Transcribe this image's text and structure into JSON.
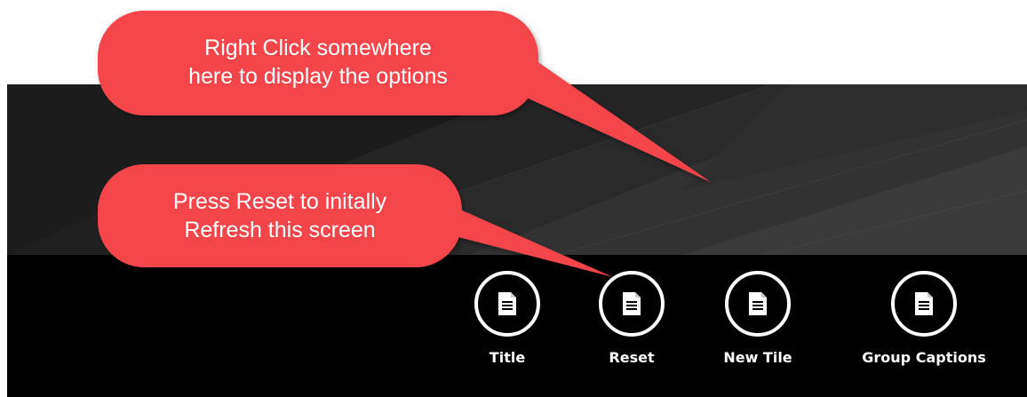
{
  "callouts": {
    "right_click": {
      "line1": "Right Click somewhere",
      "line2": "here to display the options"
    },
    "reset": {
      "line1": "Press Reset to initally",
      "line2": "Refresh this screen"
    }
  },
  "app_bar": {
    "buttons": [
      {
        "label": "Title",
        "icon": "document-icon"
      },
      {
        "label": "Reset",
        "icon": "document-icon"
      },
      {
        "label": "New Tile",
        "icon": "document-icon"
      },
      {
        "label": "Group Captions",
        "icon": "document-icon"
      }
    ]
  },
  "colors": {
    "callout_fill": "#f4454b",
    "background_dark": "#1c1c1c",
    "app_bar": "#000000",
    "icon_stroke": "#ffffff"
  }
}
